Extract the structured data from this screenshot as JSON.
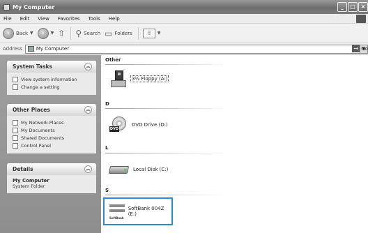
{
  "window": {
    "title": "My Computer"
  },
  "menu": [
    "File",
    "Edit",
    "View",
    "Favorites",
    "Tools",
    "Help"
  ],
  "toolbar": {
    "back_label": "Back",
    "search_label": "Search",
    "folders_label": "Folders"
  },
  "address": {
    "label": "Address",
    "value": "My Computer",
    "go_label": "Go"
  },
  "left_pane": {
    "system_tasks": {
      "title": "System Tasks",
      "items": [
        "View system information",
        "Change a setting"
      ]
    },
    "other_places": {
      "title": "Other Places",
      "items": [
        "My Network Places",
        "My Documents",
        "Shared Documents",
        "Control Panel"
      ]
    },
    "details": {
      "title": "Details",
      "name": "My Computer",
      "type": "System Folder"
    }
  },
  "groups": [
    {
      "header": "Other",
      "drives": [
        {
          "label": "3½ Floppy (A:)",
          "icon": "floppy-icon"
        }
      ]
    },
    {
      "header": "D",
      "drives": [
        {
          "label": "DVD Drive (D:)",
          "icon": "dvd-drive-icon",
          "badge": "DVD"
        }
      ]
    },
    {
      "header": "L",
      "drives": [
        {
          "label": "Local Disk (C:)",
          "icon": "hard-disk-icon"
        }
      ]
    },
    {
      "header": "S",
      "drives": [
        {
          "label": "SoftBank 004Z (E:)",
          "icon": "softbank-device-icon",
          "brand": "SoftBank"
        }
      ]
    }
  ],
  "colors": {
    "highlight_border": "#2b8ad8",
    "sidebar_bg": "#969696"
  }
}
